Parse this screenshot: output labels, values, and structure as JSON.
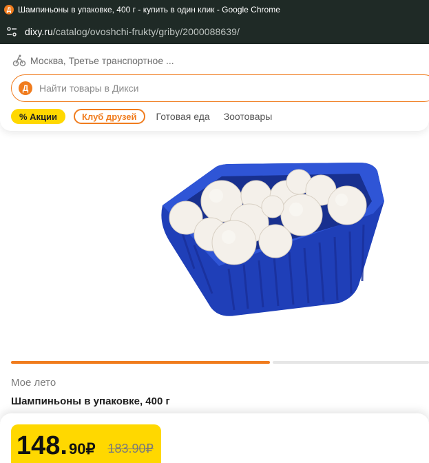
{
  "browser": {
    "window_title": "Шампиньоны в упаковке, 400 г - купить в один клик - Google Chrome",
    "url_host": "dixy.ru",
    "url_path": "/catalog/ovoshchi-frukty/griby/2000088639/"
  },
  "header": {
    "location": "Москва, Третье транспортное ...",
    "search_placeholder": "Найти товары в Дикси",
    "nav": {
      "promo": "% Акции",
      "club": "Клуб друзей",
      "ready_food": "Готовая еда",
      "pet_goods": "Зоотовары"
    }
  },
  "product": {
    "brand": "Мое лето",
    "name": "Шампиньоны в упаковке, 400 г",
    "image_icon": "mushroom-pack-image",
    "gallery_progress": 0.62,
    "price": {
      "main": "148.",
      "cents": "90₽",
      "old": "183.90₽"
    }
  },
  "colors": {
    "accent": "#f07c1e",
    "promo": "#ffd800",
    "chrome": "#1f2a26"
  }
}
